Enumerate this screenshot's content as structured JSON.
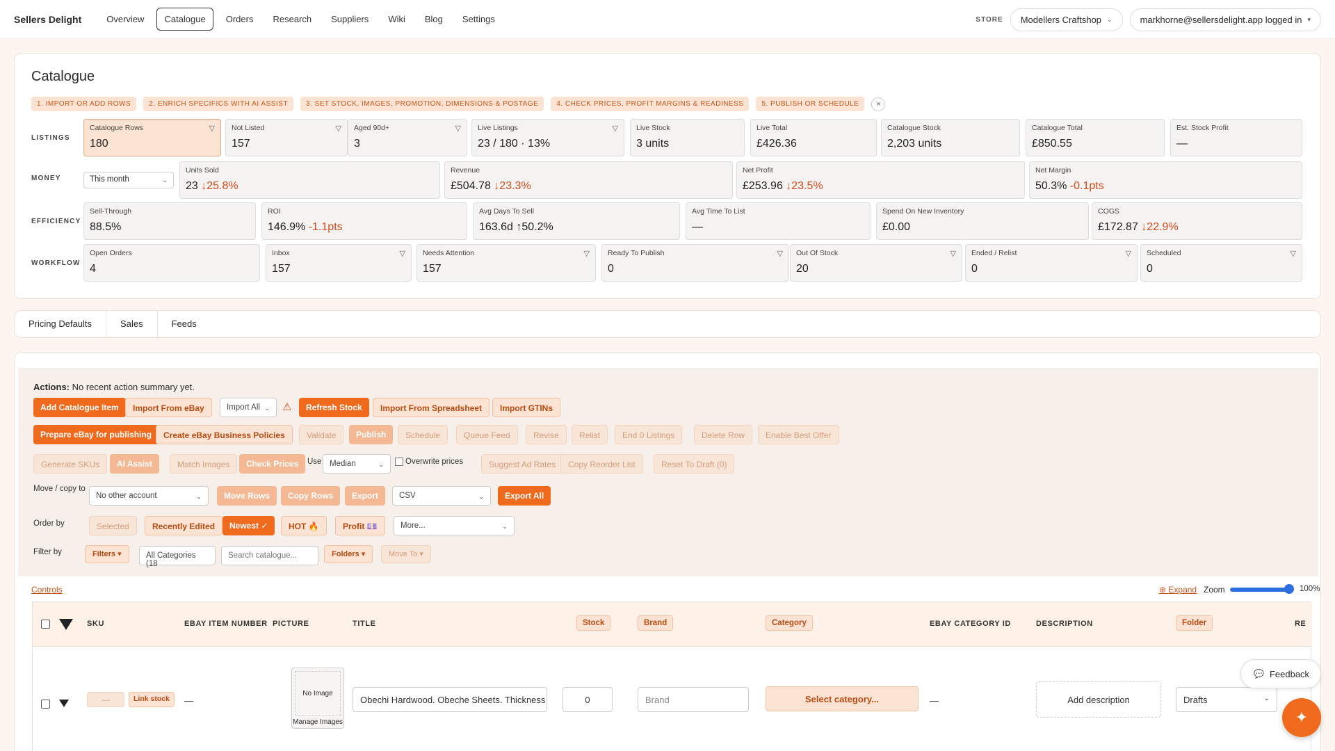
{
  "nav": {
    "brand": "Sellers Delight",
    "items": [
      "Overview",
      "Catalogue",
      "Orders",
      "Research",
      "Suppliers",
      "Wiki",
      "Blog",
      "Settings"
    ],
    "store_label": "STORE",
    "store_value": "Modellers Craftshop",
    "user": "markhorne@sellersdelight.app logged in"
  },
  "catalogue": {
    "title": "Catalogue",
    "steps": [
      "1. IMPORT OR ADD ROWS",
      "2. ENRICH SPECIFICS WITH AI ASSIST",
      "3. SET STOCK, IMAGES, PROMOTION, DIMENSIONS & POSTAGE",
      "4. CHECK PRICES, PROFIT MARGINS & READINESS",
      "5. PUBLISH OR SCHEDULE"
    ],
    "close": "×",
    "rows": {
      "listings": "LISTINGS",
      "money": "MONEY",
      "efficiency": "EFFICIENCY",
      "workflow": "WORKFLOW"
    },
    "listings": [
      {
        "label": "Catalogue Rows",
        "value": "180"
      },
      {
        "label": "Not Listed",
        "value": "157"
      },
      {
        "label": "Aged 90d+",
        "value": "3"
      },
      {
        "label": "Live Listings",
        "value": "23 / 180 · 13%"
      },
      {
        "label": "Live Stock",
        "value": "3 units"
      },
      {
        "label": "Live Total",
        "value": "£426.36"
      },
      {
        "label": "Catalogue Stock",
        "value": "2,203 units"
      },
      {
        "label": "Catalogue Total",
        "value": "£850.55"
      },
      {
        "label": "Est. Stock Profit",
        "value": "—"
      }
    ],
    "money_period": "This month",
    "money": [
      {
        "label": "Units Sold",
        "value": "23",
        "delta": "↓25.8%"
      },
      {
        "label": "Revenue",
        "value": "£504.78",
        "delta": "↓23.3%"
      },
      {
        "label": "Net Profit",
        "value": "£253.96",
        "delta": "↓23.5%"
      },
      {
        "label": "Net Margin",
        "value": "50.3%",
        "delta": "-0.1pts"
      }
    ],
    "efficiency": [
      {
        "label": "Sell-Through",
        "value": "88.5%",
        "delta": ""
      },
      {
        "label": "ROI",
        "value": "146.9%",
        "delta": "-1.1pts"
      },
      {
        "label": "Avg Days To Sell",
        "value": "163.6d",
        "delta": "↑50.2%"
      },
      {
        "label": "Avg Time To List",
        "value": "—",
        "delta": ""
      },
      {
        "label": "Spend On New Inventory",
        "value": "£0.00",
        "delta": ""
      },
      {
        "label": "COGS",
        "value": "£172.87",
        "delta": "↓22.9%"
      }
    ],
    "workflow": [
      {
        "label": "Open Orders",
        "value": "4"
      },
      {
        "label": "Inbox",
        "value": "157"
      },
      {
        "label": "Needs Attention",
        "value": "157"
      },
      {
        "label": "Ready To Publish",
        "value": "0"
      },
      {
        "label": "Out Of Stock",
        "value": "20"
      },
      {
        "label": "Ended / Relist",
        "value": "0"
      },
      {
        "label": "Scheduled",
        "value": "0"
      }
    ]
  },
  "tabs": [
    "Pricing Defaults",
    "Sales",
    "Feeds"
  ],
  "actions": {
    "title_bold": "Actions:",
    "title_rest": " No recent action summary yet.",
    "row1": [
      "Add Catalogue Item",
      "Import From eBay",
      "Import All",
      "Refresh Stock",
      "Import From Spreadsheet",
      "Import GTINs"
    ],
    "row2": [
      "Prepare eBay for publishing",
      "Create eBay Business Policies",
      "Validate",
      "Publish",
      "Schedule",
      "Queue Feed",
      "Revise",
      "Relist",
      "End 0 Listings",
      "Delete Row",
      "Enable Best Offer"
    ],
    "row3": [
      "Generate SKUs",
      "AI Assist",
      "Match Images",
      "Check Prices",
      "Use",
      "Median",
      "Overwrite prices",
      "Suggest Ad Rates",
      "Copy Reorder List",
      "Reset To Draft (0)"
    ],
    "move_label": "Move / copy to",
    "move_select": "No other account",
    "row4": [
      "Move Rows",
      "Copy Rows",
      "Export",
      "CSV",
      "Export All"
    ],
    "order_label": "Order by",
    "order": [
      "Selected",
      "Recently Edited",
      "Newest ✓",
      "HOT 🔥",
      "Profit 💷",
      "More..."
    ],
    "filter_label": "Filter by",
    "filters": [
      "Filters ▾",
      "All Categories (18",
      "Search catalogue...",
      "Folders ▾",
      "Move To ▾"
    ],
    "controls": "Controls",
    "expand": "⊕ Expand",
    "zoom_label": "Zoom",
    "zoom_value": "100%",
    "zoom_level": 1.0
  },
  "table": {
    "headers": [
      "SKU",
      "EBAY ITEM NUMBER",
      "PICTURE",
      "TITLE",
      "Stock",
      "Brand",
      "Category",
      "EBAY CATEGORY ID",
      "DESCRIPTION",
      "Folder",
      "RE"
    ],
    "row": {
      "sku": "—",
      "link_stock": "Link stock",
      "item_number": "—",
      "no_image": "No Image",
      "manage_images": "Manage Images",
      "title": "Obechi Hardwood. Obeche Sheets. Thickness",
      "stock": "0",
      "brand_placeholder": "Brand",
      "category": "Select category...",
      "category_id": "—",
      "description": "Add description",
      "folder": "Drafts"
    }
  },
  "feedback": "Feedback",
  "colors": {
    "accent": "#ef6a1c",
    "accent_light": "#fbe3d3",
    "negative": "#d24a1a"
  }
}
